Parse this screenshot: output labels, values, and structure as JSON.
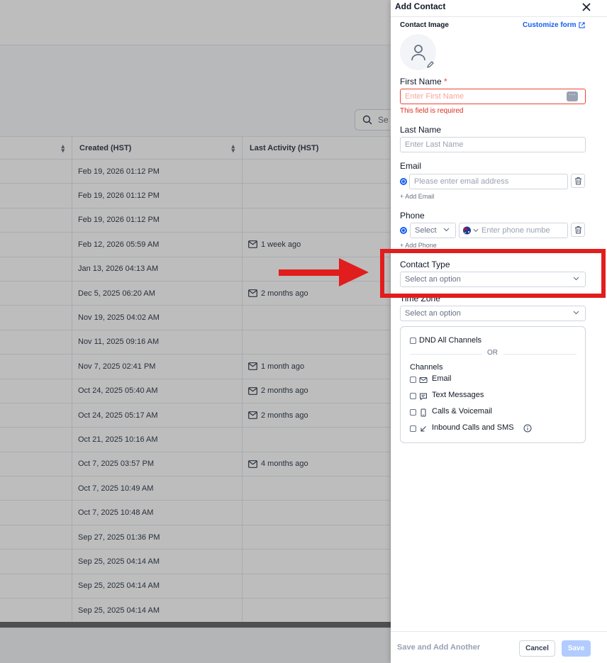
{
  "background": {
    "search_placeholder": "Se",
    "columns": [
      "",
      "Created (HST)",
      "Last Activity (HST)"
    ],
    "rows": [
      {
        "created": "Feb 19, 2026 01:12 PM",
        "activity": ""
      },
      {
        "created": "Feb 19, 2026 01:12 PM",
        "activity": ""
      },
      {
        "created": "Feb 19, 2026 01:12 PM",
        "activity": ""
      },
      {
        "created": "Feb 12, 2026 05:59 AM",
        "activity": "1 week ago"
      },
      {
        "created": "Jan 13, 2026 04:13 AM",
        "activity": ""
      },
      {
        "created": "Dec 5, 2025 06:20 AM",
        "activity": "2 months ago"
      },
      {
        "created": "Nov 19, 2025 04:02 AM",
        "activity": ""
      },
      {
        "created": "Nov 11, 2025 09:16 AM",
        "activity": ""
      },
      {
        "created": "Nov 7, 2025 02:41 PM",
        "activity": "1 month ago"
      },
      {
        "created": "Oct 24, 2025 05:40 AM",
        "activity": "2 months ago"
      },
      {
        "created": "Oct 24, 2025 05:17 AM",
        "activity": "2 months ago"
      },
      {
        "created": "Oct 21, 2025 10:16 AM",
        "activity": ""
      },
      {
        "created": "Oct 7, 2025 03:57 PM",
        "activity": "4 months ago"
      },
      {
        "created": "Oct 7, 2025 10:49 AM",
        "activity": ""
      },
      {
        "created": "Oct 7, 2025 10:48 AM",
        "activity": ""
      },
      {
        "created": "Sep 27, 2025 01:36 PM",
        "activity": ""
      },
      {
        "created": "Sep 25, 2025 04:14 AM",
        "activity": ""
      },
      {
        "created": "Sep 25, 2025 04:14 AM",
        "activity": ""
      },
      {
        "created": "Sep 25, 2025 04:14 AM",
        "activity": ""
      }
    ]
  },
  "drawer": {
    "title": "Add Contact",
    "contact_image_label": "Contact Image",
    "customize_form": "Customize form",
    "first_name": {
      "label": "First Name",
      "required_mark": "*",
      "placeholder": "Enter First Name",
      "error": "This field is required"
    },
    "last_name": {
      "label": "Last Name",
      "placeholder": "Enter Last Name"
    },
    "email": {
      "label": "Email",
      "placeholder": "Please enter email address",
      "add_link": "+ Add Email"
    },
    "phone": {
      "label": "Phone",
      "country_select": "Select",
      "placeholder": "Enter phone numbe",
      "add_link": "+ Add Phone"
    },
    "contact_type": {
      "label": "Contact Type",
      "placeholder": "Select an option"
    },
    "time_zone": {
      "label": "Time Zone",
      "placeholder": "Select an option"
    },
    "dnd": {
      "all_label": "DND All Channels",
      "or": "OR",
      "channels_label": "Channels",
      "channels": [
        "Email",
        "Text Messages",
        "Calls & Voicemail",
        "Inbound Calls and SMS"
      ]
    },
    "footer": {
      "save_and_add": "Save and Add Another",
      "cancel": "Cancel",
      "save": "Save"
    }
  },
  "colors": {
    "primary": "#155eef",
    "error": "#d92d20",
    "annotation": "#e11d1d"
  }
}
